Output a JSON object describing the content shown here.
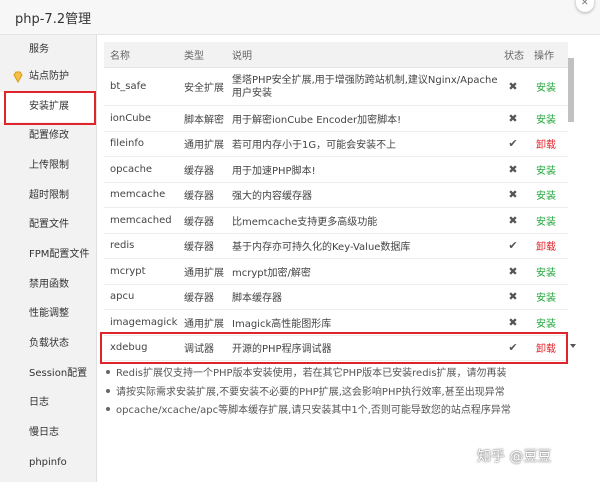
{
  "window": {
    "title": "php-7.2管理"
  },
  "sidebar": {
    "items": [
      {
        "label": "服务"
      },
      {
        "label": "站点防护"
      },
      {
        "label": "安装扩展"
      },
      {
        "label": "配置修改"
      },
      {
        "label": "上传限制"
      },
      {
        "label": "超时限制"
      },
      {
        "label": "配置文件"
      },
      {
        "label": "FPM配置文件"
      },
      {
        "label": "禁用函数"
      },
      {
        "label": "性能调整"
      },
      {
        "label": "负载状态"
      },
      {
        "label": "Session配置"
      },
      {
        "label": "日志"
      },
      {
        "label": "慢日志"
      },
      {
        "label": "phpinfo"
      }
    ],
    "active_index": 2
  },
  "table": {
    "headers": [
      "名称",
      "类型",
      "说明",
      "状态",
      "操作"
    ],
    "rows": [
      {
        "name": "bt_safe",
        "type": "安全扩展",
        "desc": "堡塔PHP安全扩展,用于增强防跨站机制,建议Nginx/Apache用户安装",
        "status": "✖",
        "action": "安装",
        "action_kind": "install"
      },
      {
        "name": "ionCube",
        "type": "脚本解密",
        "desc": "用于解密ionCube Encoder加密脚本!",
        "status": "✖",
        "action": "安装",
        "action_kind": "install"
      },
      {
        "name": "fileinfo",
        "type": "通用扩展",
        "desc": "若可用内存小于1G，可能会安装不上",
        "status": "✔",
        "action": "卸载",
        "action_kind": "uninstall"
      },
      {
        "name": "opcache",
        "type": "缓存器",
        "desc": "用于加速PHP脚本!",
        "status": "✖",
        "action": "安装",
        "action_kind": "install"
      },
      {
        "name": "memcache",
        "type": "缓存器",
        "desc": "强大的内容缓存器",
        "status": "✖",
        "action": "安装",
        "action_kind": "install"
      },
      {
        "name": "memcached",
        "type": "缓存器",
        "desc": "比memcache支持更多高级功能",
        "status": "✖",
        "action": "安装",
        "action_kind": "install"
      },
      {
        "name": "redis",
        "type": "缓存器",
        "desc": "基于内存亦可持久化的Key-Value数据库",
        "status": "✔",
        "action": "卸载",
        "action_kind": "uninstall"
      },
      {
        "name": "mcrypt",
        "type": "通用扩展",
        "desc": "mcrypt加密/解密",
        "status": "✖",
        "action": "安装",
        "action_kind": "install"
      },
      {
        "name": "apcu",
        "type": "缓存器",
        "desc": "脚本缓存器",
        "status": "✖",
        "action": "安装",
        "action_kind": "install"
      },
      {
        "name": "imagemagick",
        "type": "通用扩展",
        "desc": "Imagick高性能图形库",
        "status": "✖",
        "action": "安装",
        "action_kind": "install"
      },
      {
        "name": "xdebug",
        "type": "调试器",
        "desc": "开源的PHP程序调试器",
        "status": "✔",
        "action": "卸载",
        "action_kind": "uninstall"
      }
    ]
  },
  "notes": [
    "Redis扩展仅支持一个PHP版本安装使用，若在其它PHP版本已安装redis扩展，请勿再装",
    "请按实际需求安装扩展,不要安装不必要的PHP扩展,这会影响PHP执行效率,甚至出现异常",
    "opcache/xcache/apc等脚本缓存扩展,请只安装其中1个,否则可能导致您的站点程序异常"
  ],
  "watermark": "知乎 @豆豆",
  "colors": {
    "install": "#20a53a",
    "uninstall": "#e0242b",
    "highlight": "#e0242b"
  },
  "icons": {
    "site_protect": "diamond-icon",
    "close": "close-icon"
  }
}
